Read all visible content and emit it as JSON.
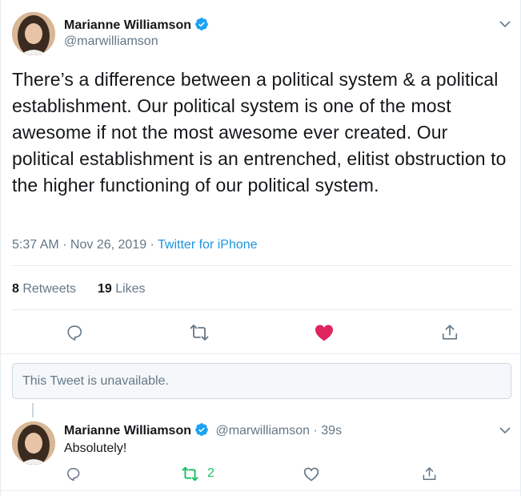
{
  "tweet": {
    "author_name": "Marianne Williamson",
    "author_handle": "@marwilliamson",
    "text": "There’s a difference between a political system & a political establishment. Our political system is one of the most awesome if not the most awesome ever created. Our political establishment is an entrenched, elitist obstruction to the higher functioning of our political system.",
    "time": "5:37 AM · Nov 26, 2019 · ",
    "source": "Twitter for iPhone",
    "retweets_count": "8",
    "retweets_label": " Retweets",
    "likes_count": "19",
    "likes_label": " Likes",
    "liked": true
  },
  "unavailable_notice": "This Tweet is unavailable.",
  "reply": {
    "author_name": "Marianne Williamson",
    "author_handle": "@marwilliamson",
    "separator": " · ",
    "age": "39s",
    "text": "Absolutely!",
    "retweet_count": "2",
    "retweeted": true
  },
  "colors": {
    "verified": "#1da1f2",
    "link": "#1b95e0",
    "like": "#e0245e",
    "retweet_active": "#17bf63",
    "icon": "#657786"
  },
  "icons": [
    "chevron-down-icon",
    "verified-badge-icon",
    "reply-icon",
    "retweet-icon",
    "like-icon",
    "share-icon"
  ]
}
